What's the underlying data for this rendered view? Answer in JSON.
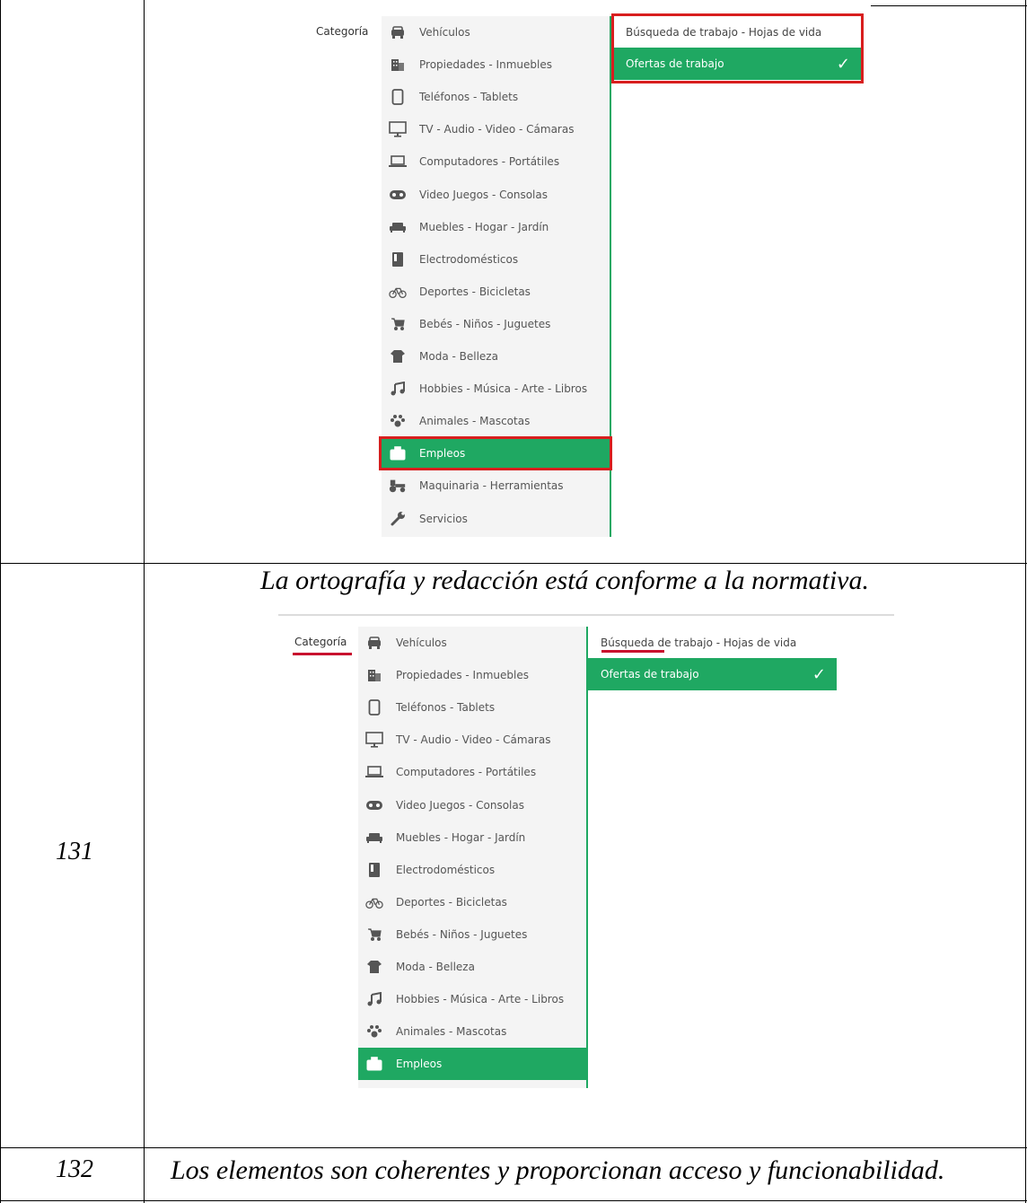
{
  "table": {
    "row_131": {
      "number": "131",
      "caption": "La ortografía y redacción está conforme a la normativa."
    },
    "row_132": {
      "number": "132",
      "caption": "Los elementos son coherentes y proporcionan acceso y funcionabilidad."
    }
  },
  "panel_top": {
    "category_label": "Categoría",
    "categories": [
      {
        "label": "Vehículos",
        "icon": "car-icon"
      },
      {
        "label": "Propiedades - Inmuebles",
        "icon": "building-icon"
      },
      {
        "label": "Teléfonos - Tablets",
        "icon": "phone-icon"
      },
      {
        "label": "TV - Audio - Video - Cámaras",
        "icon": "monitor-icon"
      },
      {
        "label": "Computadores - Portátiles",
        "icon": "laptop-icon"
      },
      {
        "label": "Video Juegos - Consolas",
        "icon": "gamepad-icon"
      },
      {
        "label": "Muebles - Hogar - Jardín",
        "icon": "sofa-icon"
      },
      {
        "label": "Electrodomésticos",
        "icon": "appliance-icon"
      },
      {
        "label": "Deportes - Bicicletas",
        "icon": "bicycle-icon"
      },
      {
        "label": "Bebés - Niños - Juguetes",
        "icon": "stroller-icon"
      },
      {
        "label": "Moda - Belleza",
        "icon": "clothes-icon"
      },
      {
        "label": "Hobbies - Música - Arte - Libros",
        "icon": "music-icon"
      },
      {
        "label": "Animales - Mascotas",
        "icon": "paw-icon"
      },
      {
        "label": "Empleos",
        "icon": "briefcase-icon"
      },
      {
        "label": "Maquinaria - Herramientas",
        "icon": "tractor-icon"
      },
      {
        "label": "Servicios",
        "icon": "wrench-icon"
      }
    ],
    "selected_category": "Empleos",
    "subcategories": [
      {
        "label": "Búsqueda de trabajo - Hojas de vida"
      },
      {
        "label": "Ofertas de trabajo"
      }
    ],
    "selected_subcategory": "Ofertas de trabajo"
  },
  "panel_bottom": {
    "category_label": "Categoría",
    "categories": [
      {
        "label": "Vehículos",
        "icon": "car-icon"
      },
      {
        "label": "Propiedades - Inmuebles",
        "icon": "building-icon"
      },
      {
        "label": "Teléfonos - Tablets",
        "icon": "phone-icon"
      },
      {
        "label": "TV - Audio - Video - Cámaras",
        "icon": "monitor-icon"
      },
      {
        "label": "Computadores - Portátiles",
        "icon": "laptop-icon"
      },
      {
        "label": "Video Juegos - Consolas",
        "icon": "gamepad-icon"
      },
      {
        "label": "Muebles - Hogar - Jardín",
        "icon": "sofa-icon"
      },
      {
        "label": "Electrodomésticos",
        "icon": "appliance-icon"
      },
      {
        "label": "Deportes - Bicicletas",
        "icon": "bicycle-icon"
      },
      {
        "label": "Bebés - Niños - Juguetes",
        "icon": "stroller-icon"
      },
      {
        "label": "Moda - Belleza",
        "icon": "clothes-icon"
      },
      {
        "label": "Hobbies - Música - Arte - Libros",
        "icon": "music-icon"
      },
      {
        "label": "Animales - Mascotas",
        "icon": "paw-icon"
      },
      {
        "label": "Empleos",
        "icon": "briefcase-icon"
      }
    ],
    "selected_category": "Empleos",
    "subcategories": [
      {
        "label": "Búsqueda de trabajo - Hojas de vida"
      },
      {
        "label": "Ofertas de trabajo"
      }
    ],
    "selected_subcategory": "Ofertas de trabajo"
  },
  "colors": {
    "accent_green": "#1fa862",
    "highlight_red": "#d81e1e",
    "menu_bg": "#f4f4f4"
  }
}
